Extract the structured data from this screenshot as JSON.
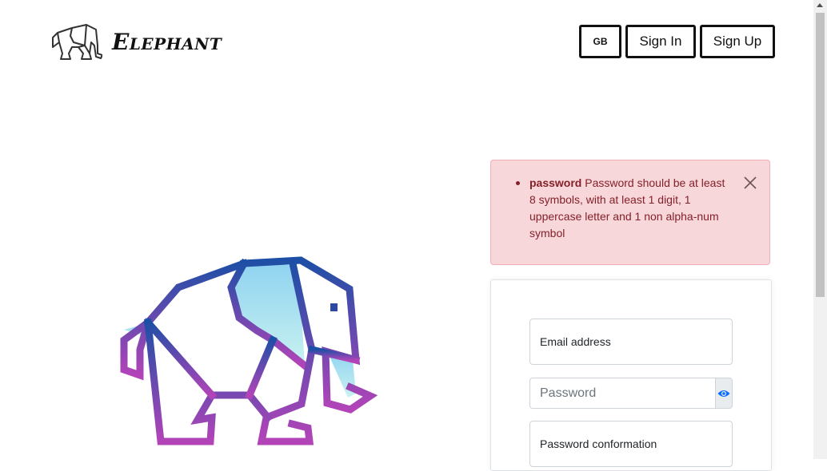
{
  "brand": {
    "name": "Elephant"
  },
  "nav": {
    "lang_label": "GB",
    "signin_label": "Sign In",
    "signup_label": "Sign Up"
  },
  "alert": {
    "errors": [
      {
        "field": "password",
        "message": "Password should be at least 8 symbols, with at least 1 digit, 1 uppercase letter and 1 non alpha-num symbol"
      }
    ]
  },
  "form": {
    "email_label": "Email address",
    "password_placeholder": "Password",
    "confirm_label": "Password conformation"
  },
  "colors": {
    "alert_bg": "#f8d7da",
    "alert_text": "#842029",
    "eye_icon": "#0d6efd",
    "gradient_top": "#1e4fa6",
    "gradient_bottom": "#b244b8"
  },
  "icons": {
    "logo": "elephant-outline-icon",
    "close": "close-icon",
    "eye": "eye-icon"
  }
}
